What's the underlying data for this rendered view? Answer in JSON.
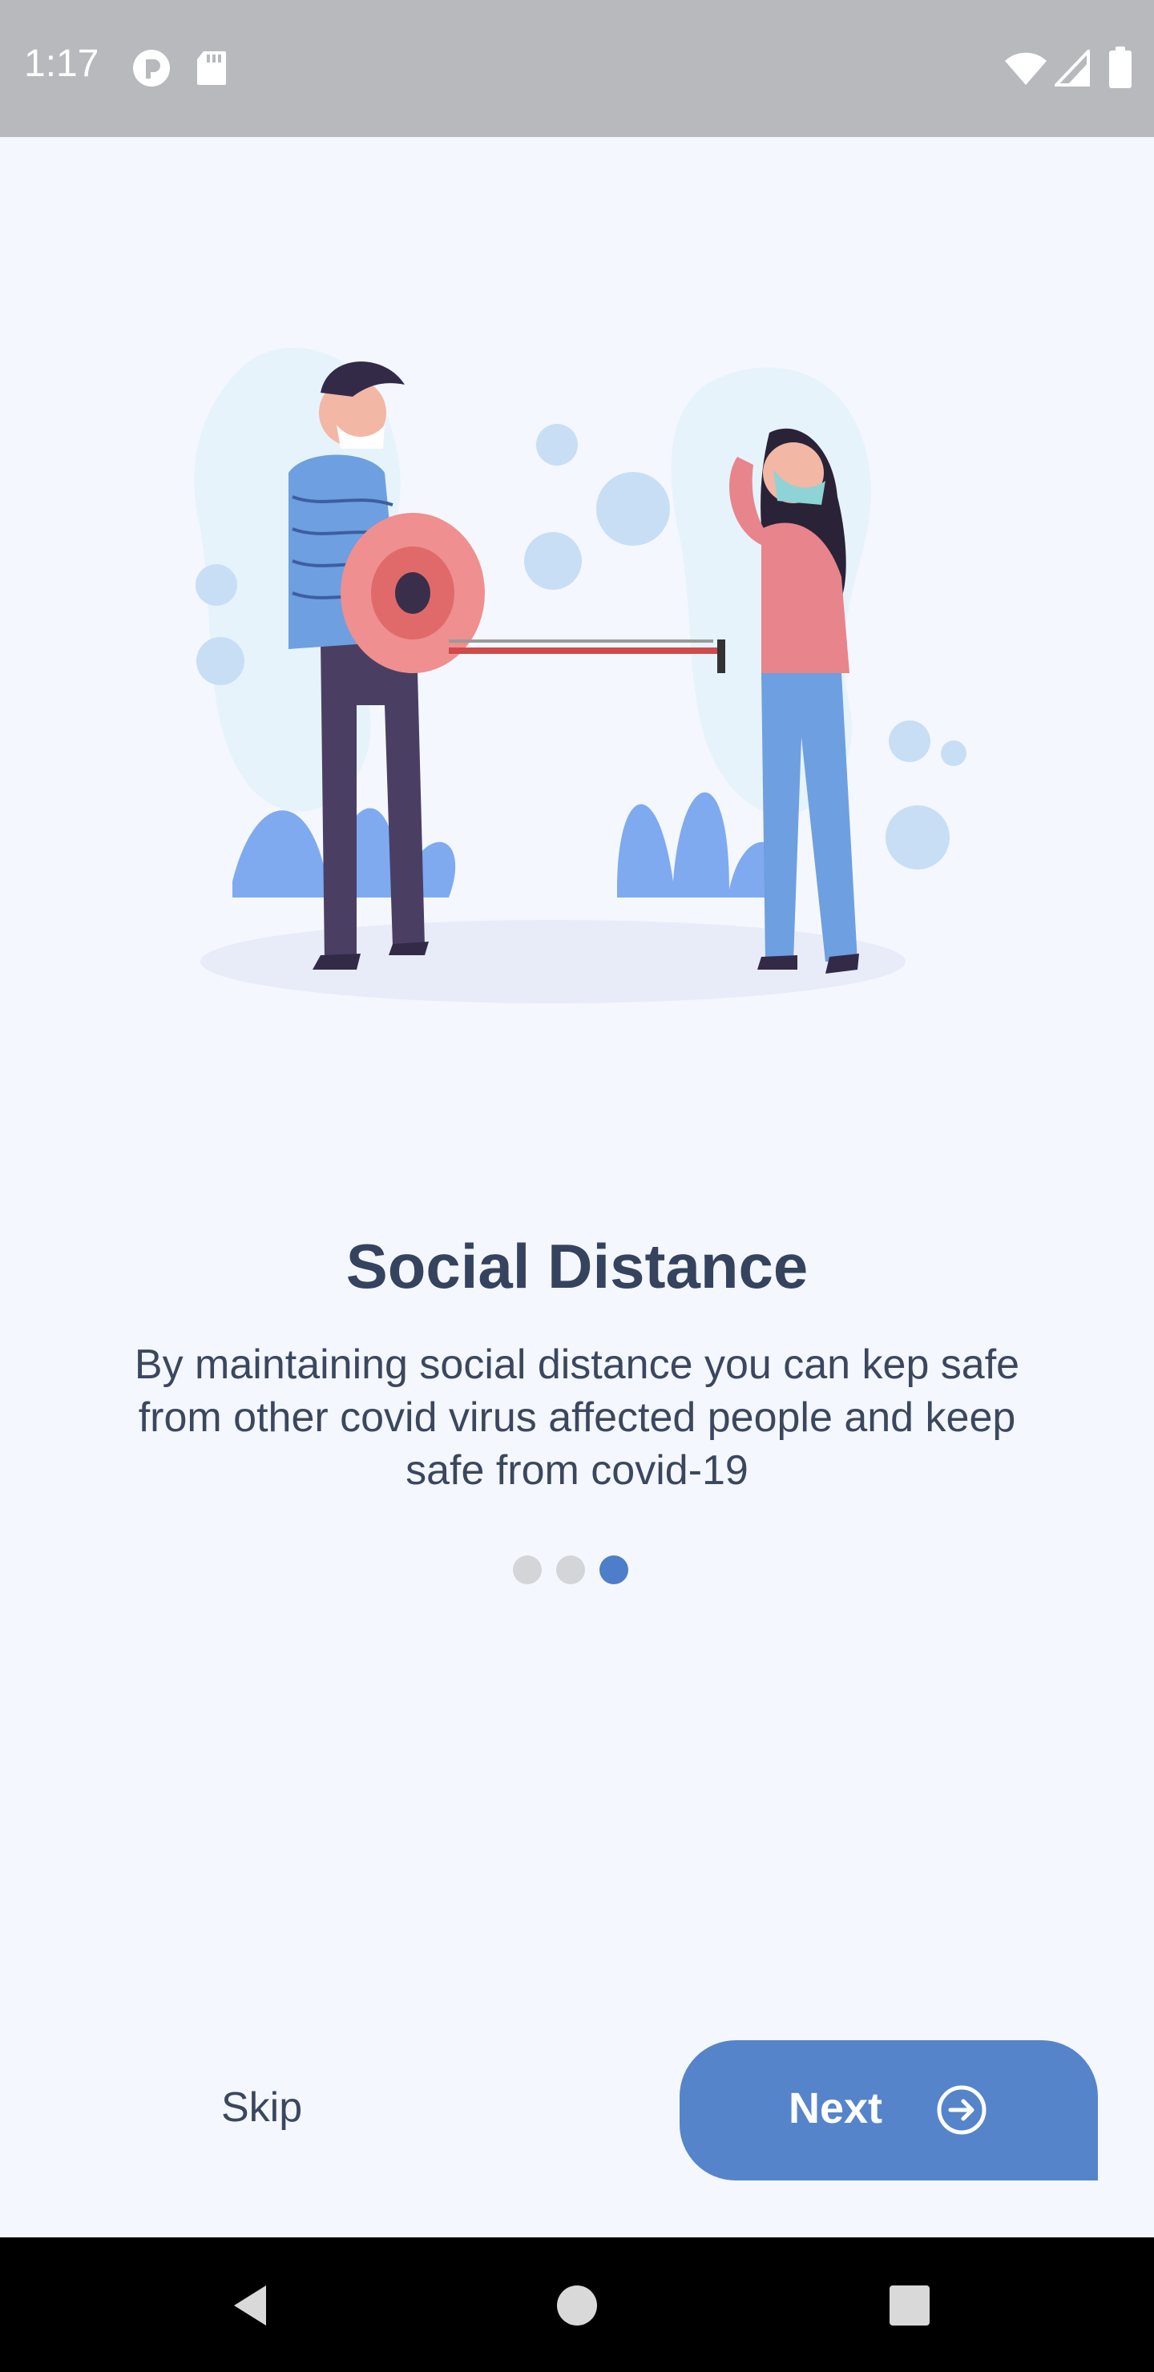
{
  "status_bar": {
    "time": "1:17",
    "icons": [
      "app-notification-icon",
      "sd-card-icon",
      "wifi-icon",
      "cellular-signal-icon",
      "battery-icon"
    ]
  },
  "onboarding": {
    "illustration": "social-distance-illustration",
    "title": "Social Distance",
    "description": "By maintaining social distance you can kep safe from other covid virus affected people and keep safe from covid-19",
    "page_indicator": {
      "total": 3,
      "current": 3
    }
  },
  "actions": {
    "skip_label": "Skip",
    "next_label": "Next",
    "next_icon": "arrow-right-circle-icon"
  },
  "colors": {
    "background": "#f4f7fd",
    "accent": "#5584ca",
    "title": "#35435e",
    "dot_inactive": "#d4d5d8",
    "dot_active": "#4e7ec9"
  },
  "nav_bar": {
    "buttons": [
      "back-icon",
      "home-icon",
      "recents-icon"
    ]
  }
}
